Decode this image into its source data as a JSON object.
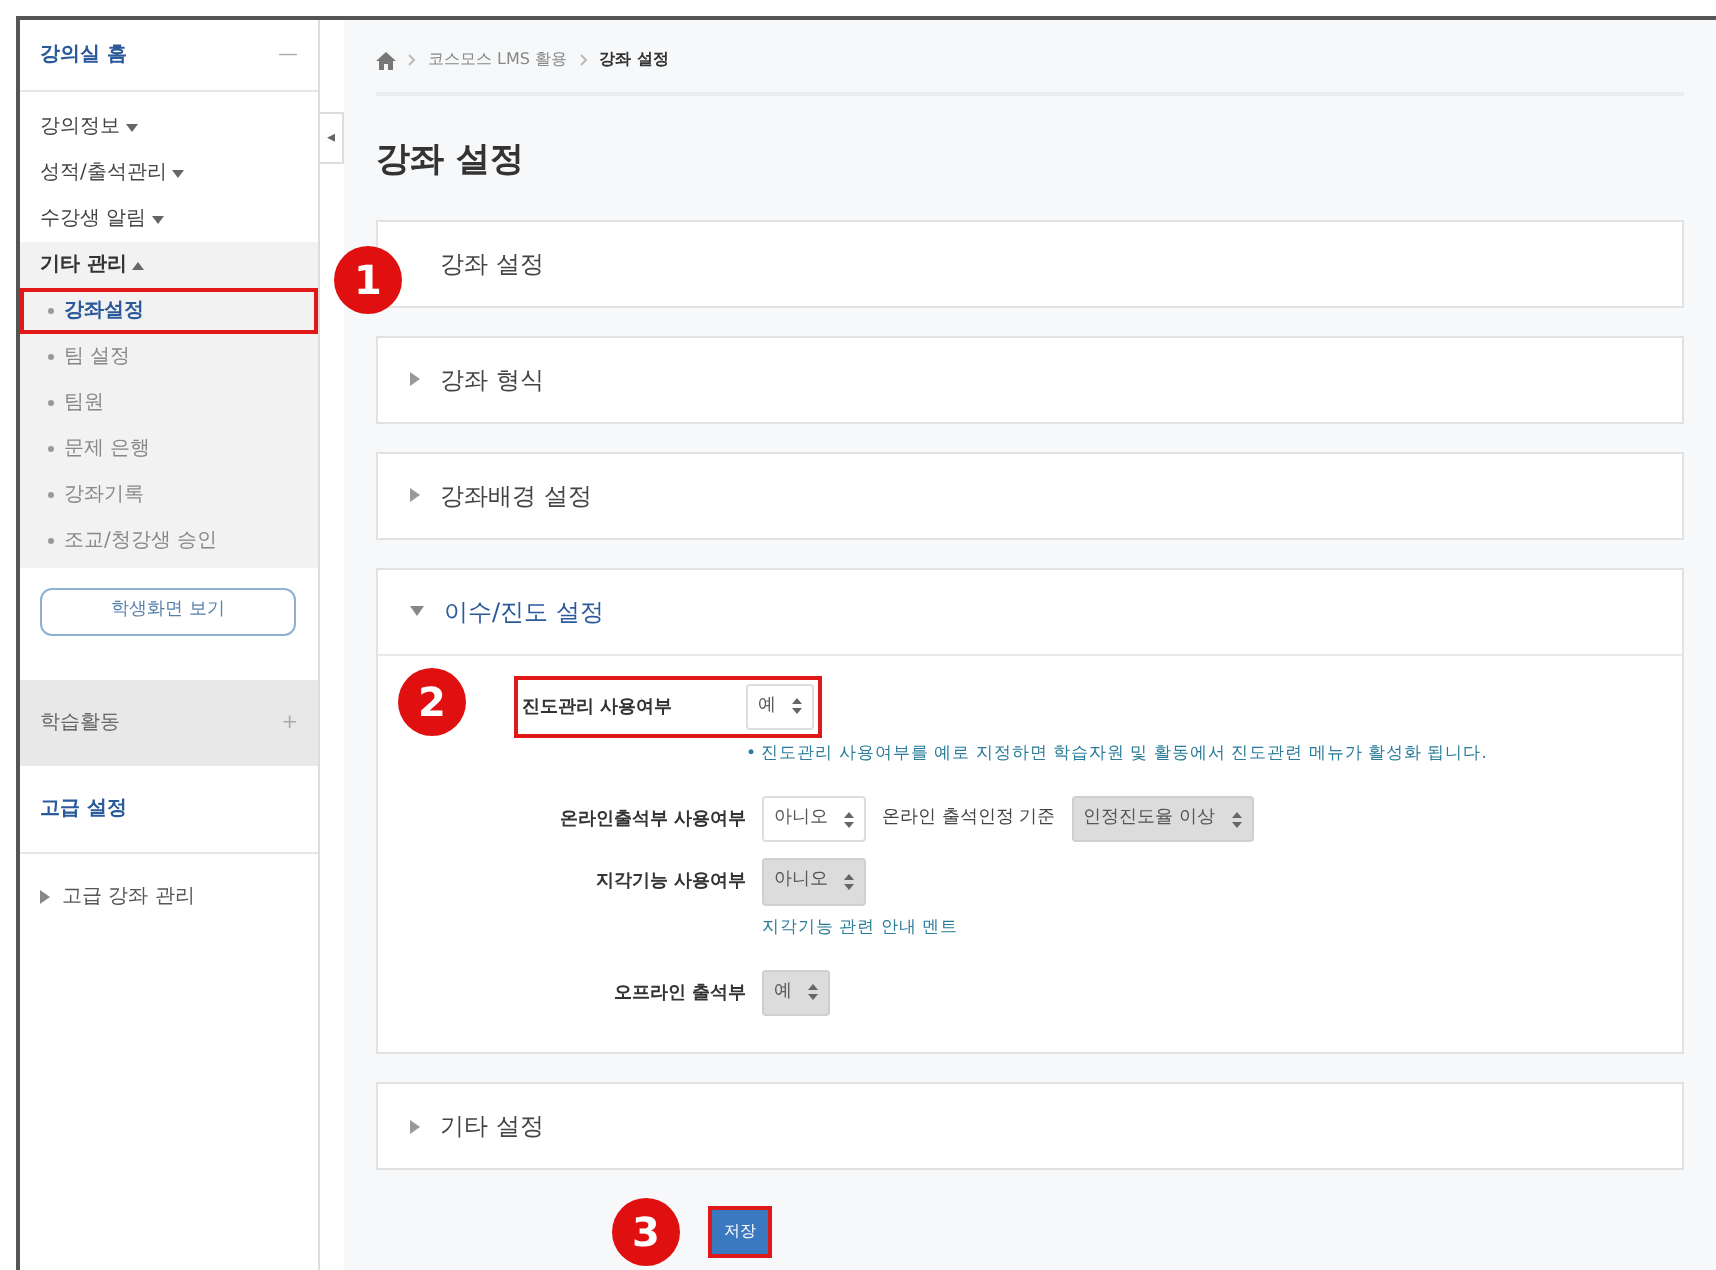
{
  "sidebar": {
    "home": {
      "label": "강의실 홈",
      "toggle": "—"
    },
    "menus": [
      {
        "label": "강의정보",
        "expanded": false
      },
      {
        "label": "성적/출석관리",
        "expanded": false
      },
      {
        "label": "수강생 알림",
        "expanded": false
      },
      {
        "label": "기타 관리",
        "expanded": true,
        "children": [
          {
            "label": "강좌설정",
            "selected": true,
            "outlined": true
          },
          {
            "label": "팀 설정",
            "selected": false,
            "outlined": false
          },
          {
            "label": "팀원",
            "selected": false,
            "outlined": false
          },
          {
            "label": "문제 은행",
            "selected": false,
            "outlined": false
          },
          {
            "label": "강좌기록",
            "selected": false,
            "outlined": false
          },
          {
            "label": "조교/청강생 승인",
            "selected": false,
            "outlined": false
          }
        ]
      }
    ],
    "student_view_button": "학생화면 보기",
    "activities": {
      "label": "학습활동",
      "toggle": "+"
    },
    "advanced": {
      "label": "고급 설정",
      "items": [
        {
          "label": "고급 강좌 관리",
          "expanded": false
        }
      ]
    }
  },
  "collapse_toggle": "◂",
  "breadcrumb": [
    {
      "label": "코스모스 LMS 활용",
      "current": false
    },
    {
      "label": "강좌 설정",
      "current": true
    }
  ],
  "page_title": "강좌 설정",
  "sections": [
    {
      "title": "강좌 설정",
      "expanded": false,
      "marker": "1"
    },
    {
      "title": "강좌 형식",
      "expanded": false
    },
    {
      "title": "강좌배경 설정",
      "expanded": false
    },
    {
      "title": "이수/진도 설정",
      "expanded": true,
      "fields": [
        {
          "label": "진도관리 사용여부",
          "value": "예",
          "disabled": false,
          "outlined": true,
          "marker": "2",
          "help": "• 진도관리 사용여부를 예로 지정하면 학습자원 및 활동에서 진도관련 메뉴가 활성화 됩니다."
        },
        {
          "label": "온라인출석부 사용여부",
          "value": "아니오",
          "disabled": false,
          "outlined": false,
          "extra_label": "온라인 출석인정 기준",
          "extra_value": "인정진도율 이상",
          "extra_disabled": true
        },
        {
          "label": "지각기능 사용여부",
          "value": "아니오",
          "disabled": true,
          "outlined": false,
          "link": "지각기능 관련 안내 멘트"
        },
        {
          "label": "오프라인 출석부",
          "value": "예",
          "disabled": true,
          "outlined": false
        }
      ]
    },
    {
      "title": "기타 설정",
      "expanded": false
    }
  ],
  "save_button": {
    "label": "저장",
    "outlined": true,
    "marker": "3"
  }
}
